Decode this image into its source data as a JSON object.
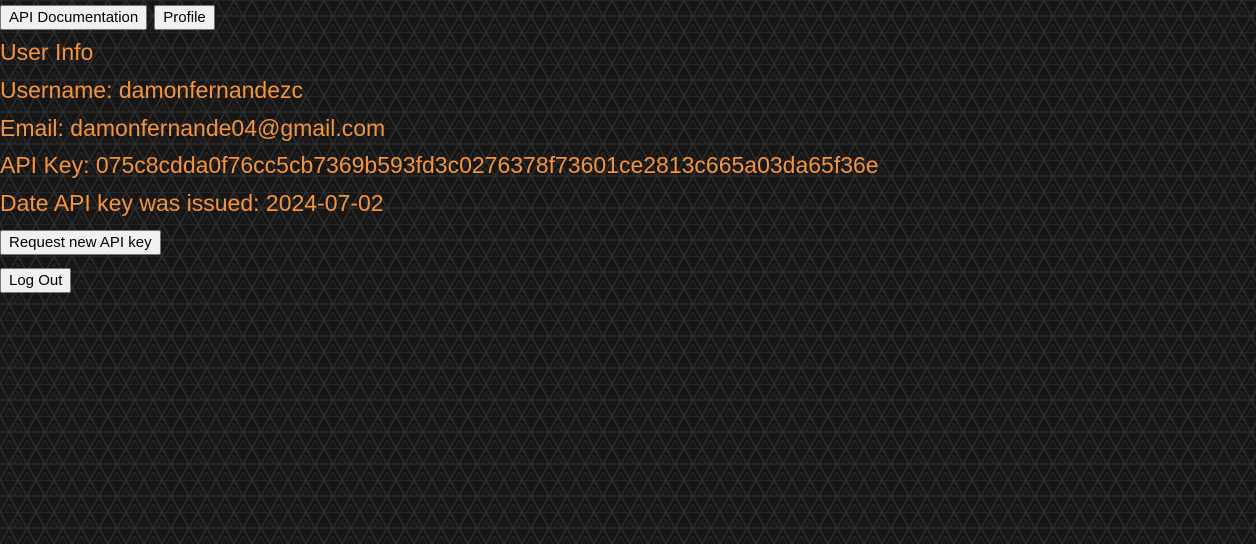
{
  "nav": {
    "api_docs_label": "API Documentation",
    "profile_label": "Profile"
  },
  "user_info": {
    "heading": "User Info",
    "username_label": "Username:",
    "username": "damonfernandezc",
    "email_label": "Email:",
    "email": "damonfernande04@gmail.com",
    "api_key_label": "API Key:",
    "api_key": "075c8cdda0f76cc5cb7369b593fd3c0276378f73601ce2813c665a03da65f36e",
    "date_label": "Date API key was issued:",
    "date_issued": "2024-07-02"
  },
  "actions": {
    "request_key_label": "Request new API key",
    "logout_label": "Log Out"
  },
  "colors": {
    "background": "#161616",
    "pattern_line": "#2c2c2c",
    "text_accent": "#f5933d",
    "button_bg": "#f0f0f0",
    "button_border": "#767676"
  }
}
